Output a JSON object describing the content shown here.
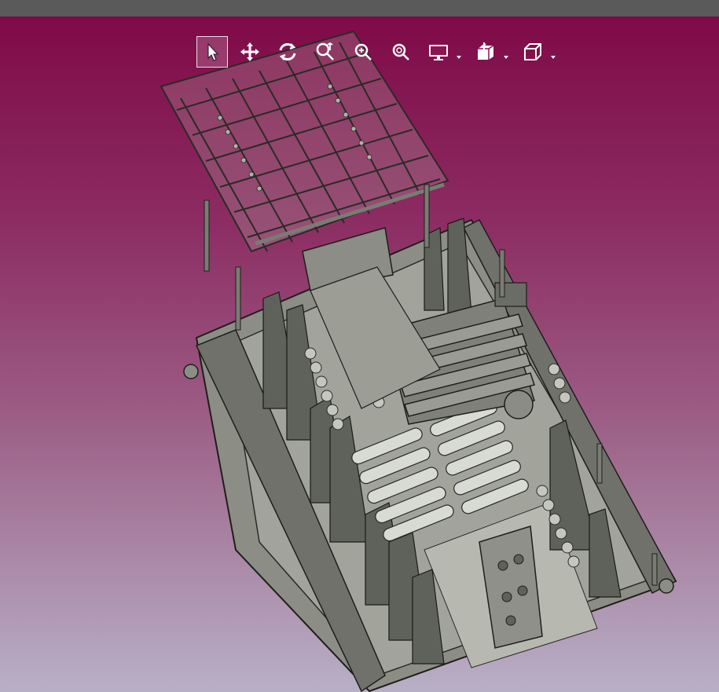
{
  "window": {
    "title": ""
  },
  "toolbar": {
    "buttons": [
      {
        "id": "select",
        "icon": "pointer-icon",
        "active": true
      },
      {
        "id": "pan",
        "icon": "move-arrows-icon",
        "active": false
      },
      {
        "id": "rotate",
        "icon": "rotate-icon",
        "active": false
      },
      {
        "id": "zoom-window",
        "icon": "zoom-box-icon",
        "active": false
      },
      {
        "id": "zoom-fit",
        "icon": "zoom-fit-icon",
        "active": false
      },
      {
        "id": "zoom",
        "icon": "zoom-icon",
        "active": false
      },
      {
        "id": "display",
        "icon": "monitor-icon",
        "active": false,
        "dropdown": true
      },
      {
        "id": "section",
        "icon": "section-box-icon",
        "active": false,
        "dropdown": true
      },
      {
        "id": "view",
        "icon": "cube-icon",
        "active": false,
        "dropdown": true
      }
    ]
  },
  "viewport": {
    "background_top": "#7f0a48",
    "background_bottom": "#b8b0c6",
    "model_color": "#8f9188",
    "model_edge_color": "#1e1e1a"
  }
}
